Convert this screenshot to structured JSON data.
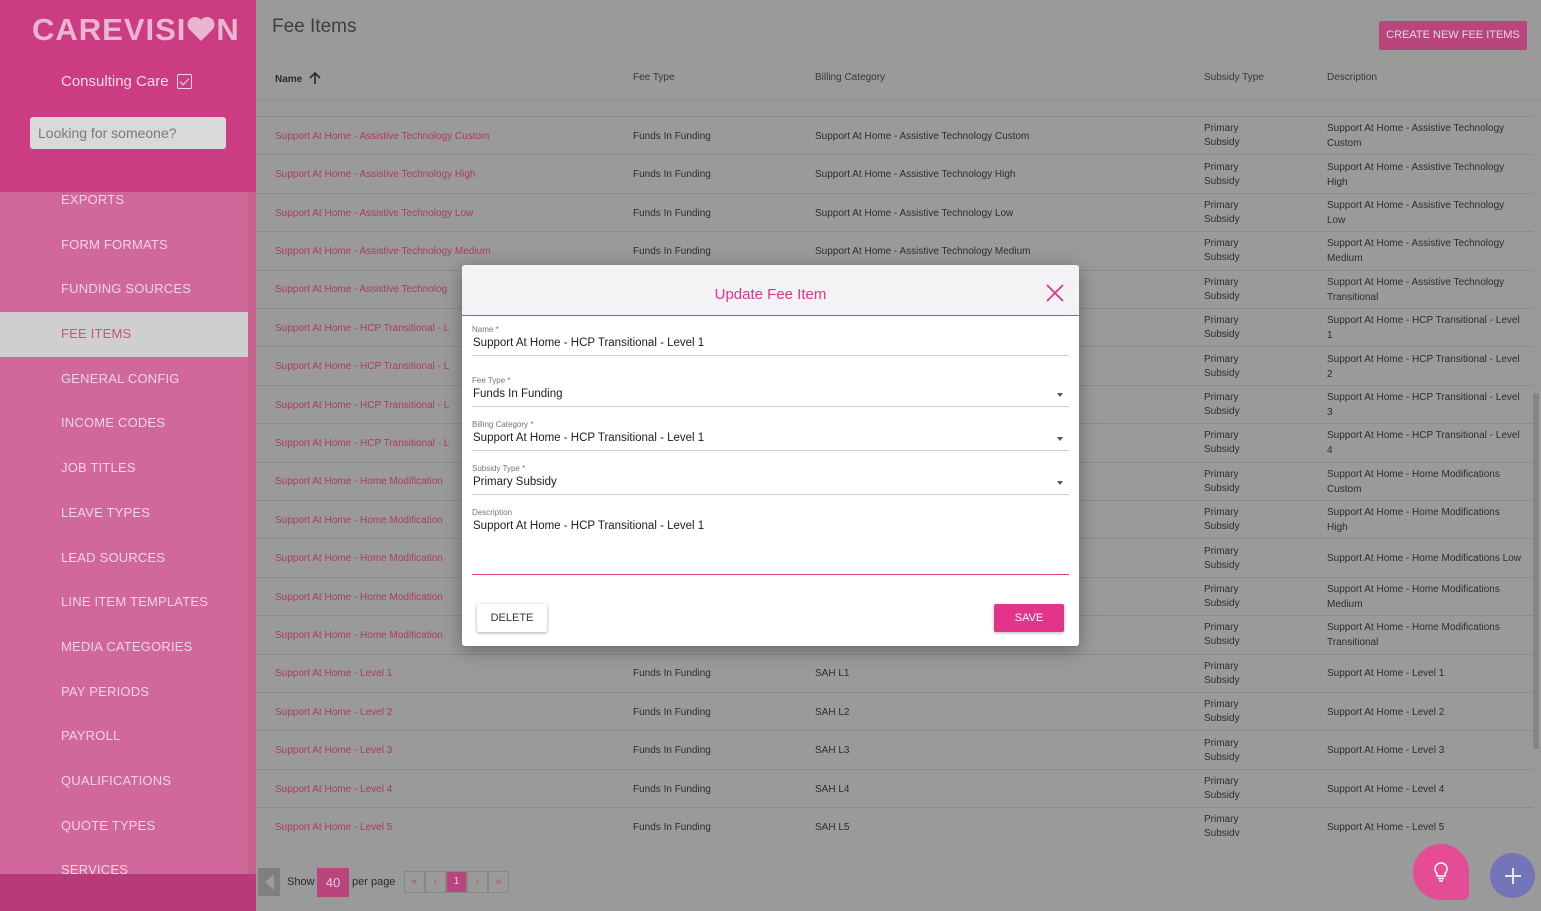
{
  "brand": {
    "logo_text": "CAREVISI",
    "logo_tail": "N"
  },
  "sidebar": {
    "org_name": "Consulting Care",
    "search_placeholder": "Looking for someone?",
    "items": [
      {
        "label": "EXPORTS",
        "active": false
      },
      {
        "label": "FORM FORMATS",
        "active": false
      },
      {
        "label": "FUNDING SOURCES",
        "active": false
      },
      {
        "label": "FEE ITEMS",
        "active": true
      },
      {
        "label": "GENERAL CONFIG",
        "active": false
      },
      {
        "label": "INCOME CODES",
        "active": false
      },
      {
        "label": "JOB TITLES",
        "active": false
      },
      {
        "label": "LEAVE TYPES",
        "active": false
      },
      {
        "label": "LEAD SOURCES",
        "active": false
      },
      {
        "label": "LINE ITEM TEMPLATES",
        "active": false
      },
      {
        "label": "MEDIA CATEGORIES",
        "active": false
      },
      {
        "label": "PAY PERIODS",
        "active": false
      },
      {
        "label": "PAYROLL",
        "active": false
      },
      {
        "label": "QUALIFICATIONS",
        "active": false
      },
      {
        "label": "QUOTE TYPES",
        "active": false
      },
      {
        "label": "SERVICES",
        "active": false
      }
    ]
  },
  "header": {
    "title": "Fee Items",
    "create_label": "CREATE NEW FEE ITEMS"
  },
  "table": {
    "columns": {
      "name": "Name",
      "fee_type": "Fee Type",
      "billing": "Billing Category",
      "subsidy": "Subsidy Type",
      "description": "Description"
    },
    "rows": [
      {
        "name": "Support At Home - Assistive Technology Custom",
        "fee_type": "Funds In Funding",
        "billing": "Support At Home - Assistive Technology Custom",
        "subsidy": "Primary Subsidy",
        "description": "Support At Home - Assistive Technology Custom"
      },
      {
        "name": "Support At Home - Assistive Technology High",
        "fee_type": "Funds In Funding",
        "billing": "Support At Home - Assistive Technology High",
        "subsidy": "Primary Subsidy",
        "description": "Support At Home - Assistive Technology High"
      },
      {
        "name": "Support At Home - Assistive Technology Low",
        "fee_type": "Funds In Funding",
        "billing": "Support At Home - Assistive Technology Low",
        "subsidy": "Primary Subsidy",
        "description": "Support At Home - Assistive Technology Low"
      },
      {
        "name": "Support At Home - Assistive Technology Medium",
        "fee_type": "Funds In Funding",
        "billing": "Support At Home - Assistive Technology Medium",
        "subsidy": "Primary Subsidy",
        "description": "Support At Home - Assistive Technology Medium"
      },
      {
        "name": "Support At Home - Assistive Technolog",
        "fee_type": "",
        "billing": "",
        "subsidy": "Primary Subsidy",
        "description": "Support At Home - Assistive Technology Transitional"
      },
      {
        "name": "Support At Home - HCP Transitional - L",
        "fee_type": "",
        "billing": "",
        "subsidy": "Primary Subsidy",
        "description": "Support At Home - HCP Transitional - Level 1"
      },
      {
        "name": "Support At Home - HCP Transitional - L",
        "fee_type": "",
        "billing": "",
        "subsidy": "Primary Subsidy",
        "description": "Support At Home - HCP Transitional - Level 2"
      },
      {
        "name": "Support At Home - HCP Transitional - L",
        "fee_type": "",
        "billing": "",
        "subsidy": "Primary Subsidy",
        "description": "Support At Home - HCP Transitional - Level 3"
      },
      {
        "name": "Support At Home - HCP Transitional - L",
        "fee_type": "",
        "billing": "",
        "subsidy": "Primary Subsidy",
        "description": "Support At Home - HCP Transitional - Level 4"
      },
      {
        "name": "Support At Home - Home Modification",
        "fee_type": "",
        "billing": "",
        "subsidy": "Primary Subsidy",
        "description": "Support At Home - Home Modifications Custom"
      },
      {
        "name": "Support At Home - Home Modification",
        "fee_type": "",
        "billing": "",
        "subsidy": "Primary Subsidy",
        "description": "Support At Home - Home Modifications High"
      },
      {
        "name": "Support At Home - Home Modification",
        "fee_type": "",
        "billing": "",
        "subsidy": "Primary Subsidy",
        "description": "Support At Home - Home Modifications Low"
      },
      {
        "name": "Support At Home - Home Modification",
        "fee_type": "",
        "billing": "",
        "subsidy": "Primary Subsidy",
        "description": "Support At Home - Home Modifications Medium"
      },
      {
        "name": "Support At Home - Home Modification",
        "fee_type": "",
        "billing": "",
        "subsidy": "Primary Subsidy",
        "description": "Support At Home - Home Modifications Transitional"
      },
      {
        "name": "Support At Home - Level 1",
        "fee_type": "Funds In Funding",
        "billing": "SAH L1",
        "subsidy": "Primary Subsidy",
        "description": "Support At Home - Level 1"
      },
      {
        "name": "Support At Home - Level 2",
        "fee_type": "Funds In Funding",
        "billing": "SAH L2",
        "subsidy": "Primary Subsidy",
        "description": "Support At Home - Level 2"
      },
      {
        "name": "Support At Home - Level 3",
        "fee_type": "Funds In Funding",
        "billing": "SAH L3",
        "subsidy": "Primary Subsidy",
        "description": "Support At Home - Level 3"
      },
      {
        "name": "Support At Home - Level 4",
        "fee_type": "Funds In Funding",
        "billing": "SAH L4",
        "subsidy": "Primary Subsidy",
        "description": "Support At Home - Level 4"
      },
      {
        "name": "Support At Home - Level 5",
        "fee_type": "Funds In Funding",
        "billing": "SAH L5",
        "subsidy": "Primary Subsidy",
        "description": "Support At Home - Level 5"
      }
    ]
  },
  "pager": {
    "show_label": "Show",
    "page_size": "40",
    "per_page_label": "per page",
    "first": "«",
    "prev": "‹",
    "current": "1",
    "next": "›",
    "last": "»"
  },
  "modal": {
    "title": "Update Fee Item",
    "name_label": "Name *",
    "name_value": "Support At Home - HCP Transitional - Level 1",
    "fee_type_label": "Fee Type *",
    "fee_type_value": "Funds In Funding",
    "billing_label": "Billing Category *",
    "billing_value": "Support At Home - HCP Transitional - Level 1",
    "subsidy_label": "Subsidy Type *",
    "subsidy_value": "Primary Subsidy",
    "description_label": "Description",
    "description_value": "Support At Home - HCP Transitional - Level 1",
    "delete_label": "DELETE",
    "save_label": "SAVE"
  },
  "colors": {
    "brand_pink": "#e2348b",
    "sidebar_bg": "#cc3c83",
    "fab_light": "#e44d96",
    "fab_add": "#7474b8"
  },
  "icons": [
    "close-icon",
    "sort-ascending-icon",
    "chevron-down-icon",
    "lightbulb-icon",
    "plus-icon",
    "heart-icon",
    "checkbox-icon"
  ]
}
